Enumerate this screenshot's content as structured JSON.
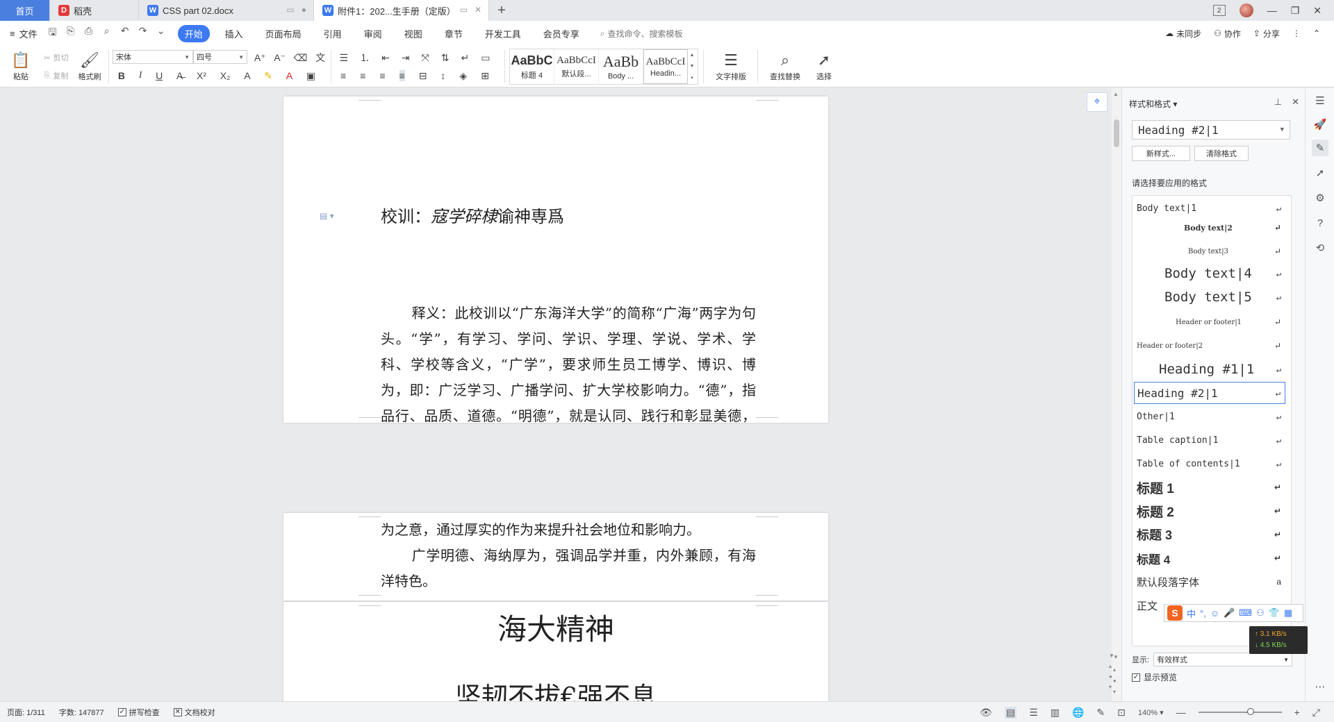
{
  "tabs": [
    {
      "label": "首页"
    },
    {
      "label": "稻壳"
    },
    {
      "label": "CSS part 02.docx"
    },
    {
      "label": "附件1：202...生手册（定版）"
    }
  ],
  "menu": {
    "file": "文件",
    "items": [
      "开始",
      "插入",
      "页面布局",
      "引用",
      "审阅",
      "视图",
      "章节",
      "开发工具",
      "会员专享"
    ],
    "active": "开始",
    "search": "查找命令、搜索模板",
    "right": [
      "未同步",
      "协作",
      "分享"
    ]
  },
  "ribbon": {
    "paste": "粘贴",
    "cut": "剪切",
    "copy": "复制",
    "format_painter": "格式刷",
    "font_name": "宋体",
    "font_size": "四号",
    "styles": [
      {
        "sample": "AaBbC",
        "name": "标题 4"
      },
      {
        "sample": "AaBbCcI",
        "name": "默认段..."
      },
      {
        "sample": "AaBb",
        "name": "Body ..."
      },
      {
        "sample": "AaBbCcI",
        "name": "Headin..."
      }
    ],
    "text_layout": "文字排版",
    "find_replace": "查找替换",
    "select": "选择"
  },
  "document": {
    "motto_prefix": "校训：",
    "motto_italic": "寇学碎棣",
    "motto_rest": "谕神専爲",
    "para1_a": "释义：此校训以“广东海洋大学”的简称“广海”两字为句头。“学”，有学习、学问、学识、学理、学说、学术、学科、学校等含义，“广学”，要求师生员工博学、博识、博为，即：广泛学习、广播学问、扩大学校影响力。“德”，指品行、品质、道德。“明德”，就是认同、践行和彰显美德，体现以德为立校之本、以德为立人之本。“海纳”，广泛采纳。“厚为”，既有重视行为、勤动手之意，提倡实干精神，培养“三能”应用型人才；也有厚实的作为、大有作",
    "para1_b": "为之意，通过厚实的作为来提升社会地位和影响力。",
    "para2": "广学明德、海纳厚为，强调品学并重，内外兼顾，有海洋特色。",
    "heading": "海大精神",
    "subheading": "坚韧不拔€强不息"
  },
  "pane": {
    "title": "样式和格式",
    "current_style": "Heading #2|1",
    "new_style": "新样式...",
    "clear_format": "清除格式",
    "choose_label": "请选择要应用的格式",
    "styles": [
      "Body text|1",
      "Body text|2",
      "Body text|3",
      "Body text|4",
      "Body text|5",
      "Header or footer|1",
      "Header or footer|2",
      "Heading #1|1",
      "Heading #2|1",
      "Other|1",
      "Table caption|1",
      "Table of contents|1",
      "标题 1",
      "标题 2",
      "标题 3",
      "标题 4",
      "默认段落字体",
      "正文"
    ],
    "selected_style": "Heading #2|1",
    "show_label": "显示:",
    "show_value": "有效样式",
    "preview_label": "显示预览"
  },
  "ime": {
    "lang": "中"
  },
  "netspeed": {
    "up": "3.1 KB/s",
    "down": "4.5 KB/s"
  },
  "status": {
    "page": "页面: 1/311",
    "words": "字数: 147877",
    "spell": "拼写检查",
    "proof": "文档校对",
    "zoom": "140%"
  },
  "colors": {
    "accent": "#3c79f2",
    "home_tab": "#4a7fe0",
    "page": "#ffffff",
    "canvas": "#e9eaec"
  }
}
